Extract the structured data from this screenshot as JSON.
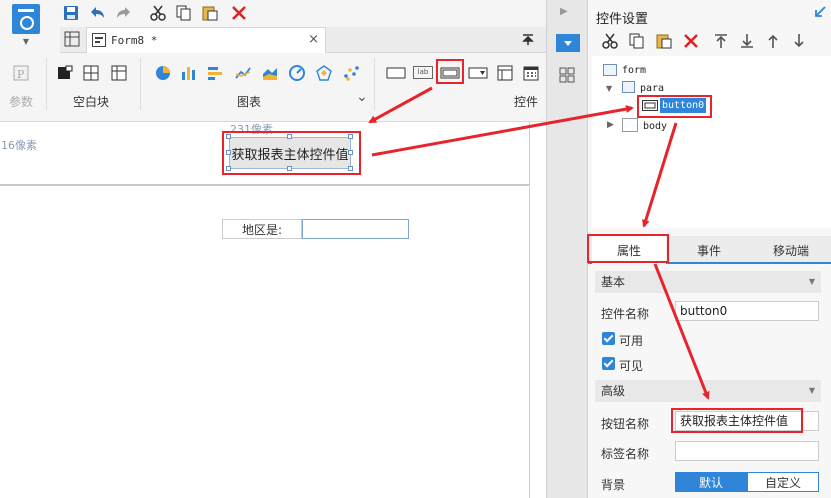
{
  "toolbar": {
    "save": "save-icon",
    "undo": "undo-icon",
    "redo": "redo-icon",
    "cut": "cut-icon",
    "copy": "copy-icon",
    "paste": "paste-icon",
    "delete": "delete-icon"
  },
  "doc_tab": {
    "label": "Form8 *",
    "close": "×"
  },
  "ribbon": {
    "groups": [
      {
        "label": "参数"
      },
      {
        "label": "空白块"
      },
      {
        "label": "图表"
      },
      {
        "label": "控件"
      }
    ],
    "chart_expand": "⌄",
    "control_sample": "lab"
  },
  "canvas": {
    "px_left": "16像素",
    "px_top": "231像素",
    "button_text": "获取报表主体控件值",
    "area_label": "地区是:",
    "area_input_value": ""
  },
  "panel": {
    "title": "控件设置",
    "tree": {
      "form": "form",
      "para": "para",
      "button": "button0",
      "body": "body"
    },
    "tabs": [
      "属性",
      "事件",
      "移动端"
    ],
    "active_tab": "属性",
    "sections": {
      "basic": "基本",
      "advanced": "高级"
    },
    "props": {
      "name_label": "控件名称",
      "name_value": "button0",
      "enabled_label": "可用",
      "visible_label": "可见",
      "btn_name_label": "按钮名称",
      "btn_name_value": "获取报表主体控件值",
      "tag_name_label": "标签名称",
      "tag_name_value": "",
      "bg_label": "背景",
      "bg_default": "默认",
      "bg_custom": "自定义"
    }
  },
  "colors": {
    "accent": "#2f85d8",
    "highlight": "#e8232b"
  }
}
